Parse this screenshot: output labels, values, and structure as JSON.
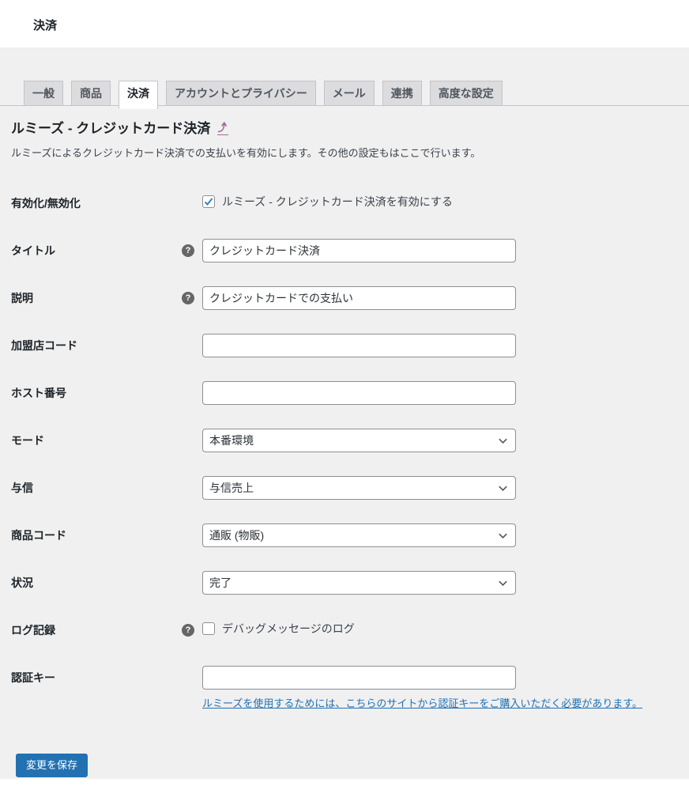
{
  "topbar": {
    "title": "決済"
  },
  "tabs": {
    "items": [
      {
        "id": "general",
        "label": "一般",
        "active": false
      },
      {
        "id": "products",
        "label": "商品",
        "active": false
      },
      {
        "id": "payments",
        "label": "決済",
        "active": true
      },
      {
        "id": "accounts-privacy",
        "label": "アカウントとプライバシー",
        "active": false
      },
      {
        "id": "emails",
        "label": "メール",
        "active": false
      },
      {
        "id": "integration",
        "label": "連携",
        "active": false
      },
      {
        "id": "advanced",
        "label": "高度な設定",
        "active": false
      }
    ]
  },
  "section": {
    "title": "ルミーズ - クレジットカード決済",
    "back_arrow_icon": "curved-up-arrow",
    "description": "ルミーズによるクレジットカード決済での支払いを有効にします。その他の設定もはここで行います。"
  },
  "form": {
    "rows": [
      {
        "id": "enable",
        "type": "checkbox",
        "label": "有効化/無効化",
        "help": false,
        "checkbox_label": "ルミーズ - クレジットカード決済を有効にする",
        "checked": true
      },
      {
        "id": "title",
        "type": "text",
        "label": "タイトル",
        "help": true,
        "value": "クレジットカード決済",
        "placeholder": ""
      },
      {
        "id": "description",
        "type": "text",
        "label": "説明",
        "help": true,
        "value": "クレジットカードでの支払い",
        "placeholder": ""
      },
      {
        "id": "merchant-code",
        "type": "text",
        "label": "加盟店コード",
        "help": false,
        "value": "",
        "placeholder": ""
      },
      {
        "id": "host-number",
        "type": "text",
        "label": "ホスト番号",
        "help": false,
        "value": "",
        "placeholder": ""
      },
      {
        "id": "mode",
        "type": "select",
        "label": "モード",
        "help": false,
        "value": "本番環境"
      },
      {
        "id": "authorization",
        "type": "select",
        "label": "与信",
        "help": false,
        "value": "与信売上"
      },
      {
        "id": "product-code",
        "type": "select",
        "label": "商品コード",
        "help": false,
        "value": "通販 (物販)"
      },
      {
        "id": "status",
        "type": "select",
        "label": "状況",
        "help": false,
        "value": "完了"
      },
      {
        "id": "logging",
        "type": "checkbox",
        "label": "ログ記録",
        "help": true,
        "checkbox_label": "デバッグメッセージのログ",
        "checked": false
      },
      {
        "id": "auth-key",
        "type": "text",
        "label": "認証キー",
        "help": false,
        "value": "",
        "placeholder": "",
        "link": "ルミーズを使用するためには、こちらのサイトから認証キーをご購入いただく必要があります。"
      }
    ],
    "help_glyph": "?"
  },
  "footer": {
    "save_label": "変更を保存"
  },
  "colors": {
    "accent": "#2271b1",
    "check": "#3582c4",
    "back_link": "#a36597",
    "canvas": "#f0f0f1",
    "tab_inactive_bg": "#dcdcde",
    "border": "#c3c4c7",
    "input_border": "#8c8f94"
  }
}
